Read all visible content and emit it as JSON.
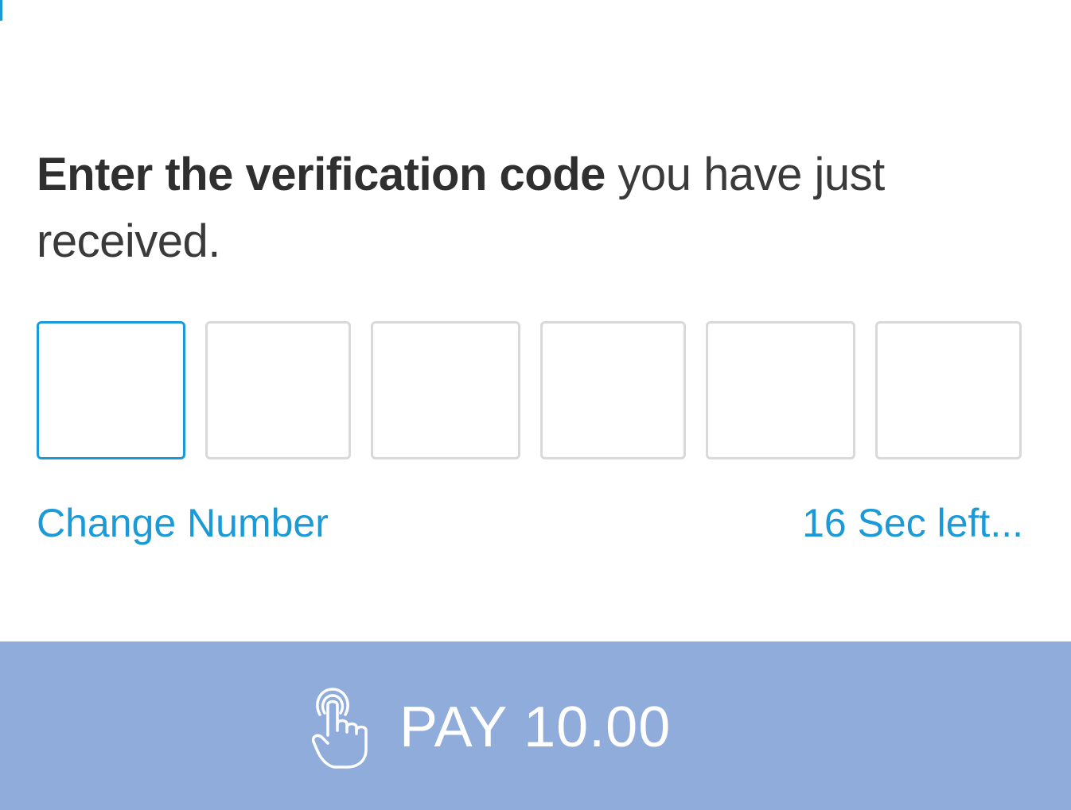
{
  "instructions": {
    "bold_text": "Enter the verification code",
    "normal_text": " you have just received."
  },
  "otp": {
    "digit_count": 6,
    "active_index": 0,
    "values": [
      "",
      "",
      "",
      "",
      "",
      ""
    ]
  },
  "links": {
    "change_number": "Change Number",
    "timer": "16 Sec left..."
  },
  "pay_button": {
    "label": "PAY 10.00",
    "icon": "tap-hand-icon"
  },
  "colors": {
    "accent": "#1a9bd7",
    "pay_bar": "#8facdb",
    "inactive_border": "#d9d9d9",
    "text": "#333333"
  }
}
